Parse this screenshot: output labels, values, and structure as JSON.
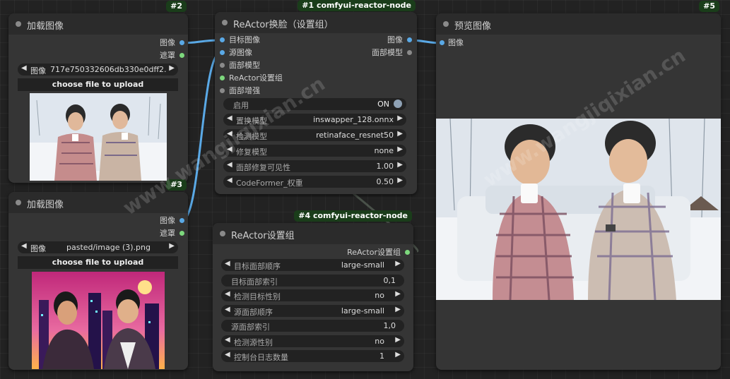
{
  "watermark": "www.wangjiqixian.cn",
  "nodes": {
    "load1": {
      "id": "#2",
      "title": "加载图像",
      "outputs": [
        "图像",
        "遮罩"
      ],
      "image_widget_label": "图像",
      "image_widget_value": "717e750332606db330e0dff2...",
      "upload_label": "choose file to upload"
    },
    "load2": {
      "id": "#3",
      "title": "加载图像",
      "outputs": [
        "图像",
        "遮罩"
      ],
      "image_widget_label": "图像",
      "image_widget_value": "pasted/image (3).png",
      "upload_label": "choose file to upload"
    },
    "reactor": {
      "badge": "#1 comfyui-reactor-node",
      "title": "ReActor换脸（设置组）",
      "inputs": [
        "目标图像",
        "源图像",
        "面部模型",
        "ReActor设置组",
        "面部增强"
      ],
      "outputs": [
        "图像",
        "面部模型"
      ],
      "enable_label": "启用",
      "enable_value": "ON",
      "widgets": [
        {
          "label": "置换模型",
          "value": "inswapper_128.onnx"
        },
        {
          "label": "检测模型",
          "value": "retinaface_resnet50"
        },
        {
          "label": "修复模型",
          "value": "none"
        },
        {
          "label": "面部修复可见性",
          "value": "1.00"
        },
        {
          "label": "CodeFormer_权重",
          "value": "0.50"
        }
      ]
    },
    "settings": {
      "badge": "#4 comfyui-reactor-node",
      "title": "ReActor设置组",
      "output": "ReActor设置组",
      "widgets": [
        {
          "label": "目标面部顺序",
          "value": "large-small",
          "arrows": true
        },
        {
          "label": "目标面部索引",
          "value": "0,1",
          "arrows": false
        },
        {
          "label": "检测目标性别",
          "value": "no",
          "arrows": true
        },
        {
          "label": "源面部顺序",
          "value": "large-small",
          "arrows": true
        },
        {
          "label": "源面部索引",
          "value": "1,0",
          "arrows": false
        },
        {
          "label": "检测源性别",
          "value": "no",
          "arrows": true
        },
        {
          "label": "控制台日志数量",
          "value": "1",
          "arrows": true
        }
      ]
    },
    "preview": {
      "id": "#5",
      "title": "预览图像",
      "input": "图像"
    }
  },
  "colors": {
    "image_wire": "#5aa9e6",
    "mask_dot": "#7dd87d",
    "badge_bg": "#1a3d1a"
  }
}
